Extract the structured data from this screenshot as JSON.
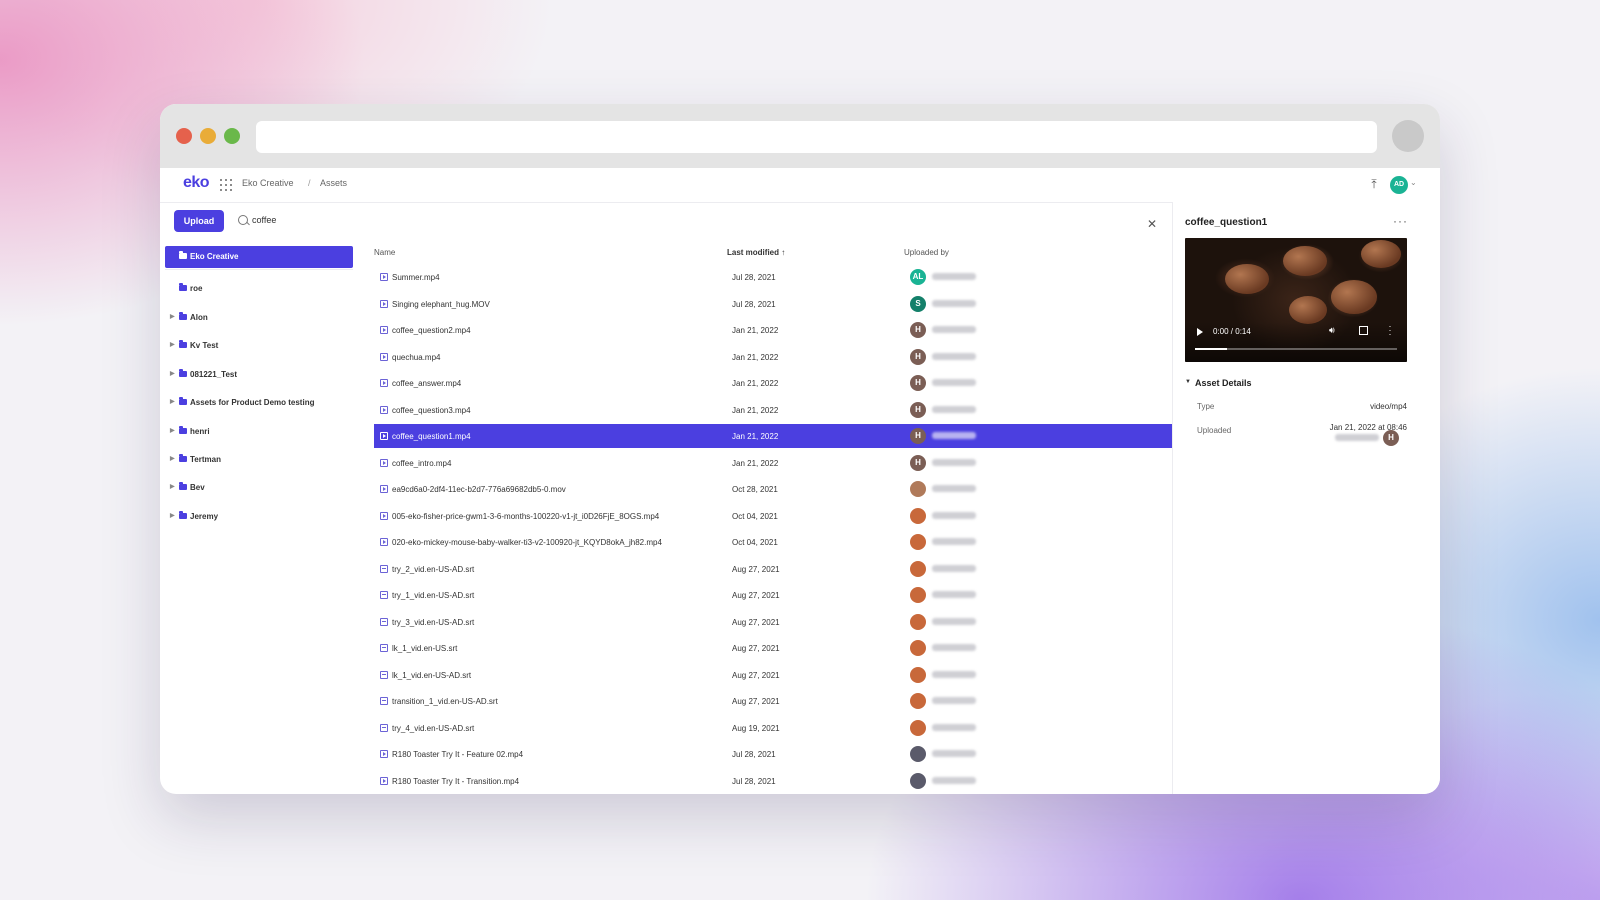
{
  "app": {
    "logo": "eko",
    "breadcrumb": [
      "Eko Creative",
      "Assets"
    ],
    "breadcrumb_separator": "/",
    "user_initials": "AD",
    "accent_color": "#4b3fe0"
  },
  "toolbar": {
    "upload_label": "Upload",
    "search_value": "coffee"
  },
  "sidebar": {
    "items": [
      {
        "label": "Eko Creative",
        "active": true,
        "expandable": false
      },
      {
        "label": "roe",
        "active": false,
        "expandable": false
      },
      {
        "label": "Alon",
        "active": false,
        "expandable": true
      },
      {
        "label": "Kv Test",
        "active": false,
        "expandable": true
      },
      {
        "label": "081221_Test",
        "active": false,
        "expandable": true
      },
      {
        "label": "Assets for Product Demo testing",
        "active": false,
        "expandable": true
      },
      {
        "label": "henri",
        "active": false,
        "expandable": true
      },
      {
        "label": "Tertman",
        "active": false,
        "expandable": true
      },
      {
        "label": "Bev",
        "active": false,
        "expandable": true
      },
      {
        "label": "Jeremy",
        "active": false,
        "expandable": true
      }
    ]
  },
  "table": {
    "columns": [
      "Name",
      "Last modified ↑",
      "Uploaded by"
    ],
    "rows": [
      {
        "name": "Summer.mp4",
        "date": "Jul 28, 2021",
        "type": "video",
        "avatar": "AL",
        "avatar_color": "#1ab394"
      },
      {
        "name": "Singing elephant_hug.MOV",
        "date": "Jul 28, 2021",
        "type": "video",
        "avatar": "S",
        "avatar_color": "#14806a"
      },
      {
        "name": "coffee_question2.mp4",
        "date": "Jan 21, 2022",
        "type": "video",
        "avatar": "H",
        "avatar_color": "#7b5e55"
      },
      {
        "name": "quechua.mp4",
        "date": "Jan 21, 2022",
        "type": "video",
        "avatar": "H",
        "avatar_color": "#7b5e55"
      },
      {
        "name": "coffee_answer.mp4",
        "date": "Jan 21, 2022",
        "type": "video",
        "avatar": "H",
        "avatar_color": "#7b5e55"
      },
      {
        "name": "coffee_question3.mp4",
        "date": "Jan 21, 2022",
        "type": "video",
        "avatar": "H",
        "avatar_color": "#7b5e55"
      },
      {
        "name": "coffee_question1.mp4",
        "date": "Jan 21, 2022",
        "type": "video",
        "avatar": "H",
        "avatar_color": "#7b5e55",
        "selected": true
      },
      {
        "name": "coffee_intro.mp4",
        "date": "Jan 21, 2022",
        "type": "video",
        "avatar": "H",
        "avatar_color": "#7b5e55"
      },
      {
        "name": "ea9cd6a0-2df4-11ec-b2d7-776a69682db5-0.mov",
        "date": "Oct 28, 2021",
        "type": "video",
        "avatar": "",
        "avatar_color": "#b07a5a"
      },
      {
        "name": "005-eko-fisher-price-gwm1-3-6-months-100220-v1-jt_i0D26FjE_8OGS.mp4",
        "date": "Oct 04, 2021",
        "type": "video",
        "avatar": "",
        "avatar_color": "#c8683a"
      },
      {
        "name": "020-eko-mickey-mouse-baby-walker-ti3-v2-100920-jt_KQYD8okA_jh82.mp4",
        "date": "Oct 04, 2021",
        "type": "video",
        "avatar": "",
        "avatar_color": "#c8683a"
      },
      {
        "name": "try_2_vid.en-US-AD.srt",
        "date": "Aug 27, 2021",
        "type": "subtitle",
        "avatar": "",
        "avatar_color": "#c8683a"
      },
      {
        "name": "try_1_vid.en-US-AD.srt",
        "date": "Aug 27, 2021",
        "type": "subtitle",
        "avatar": "",
        "avatar_color": "#c8683a"
      },
      {
        "name": "try_3_vid.en-US-AD.srt",
        "date": "Aug 27, 2021",
        "type": "subtitle",
        "avatar": "",
        "avatar_color": "#c8683a"
      },
      {
        "name": "lk_1_vid.en-US.srt",
        "date": "Aug 27, 2021",
        "type": "subtitle",
        "avatar": "",
        "avatar_color": "#c8683a"
      },
      {
        "name": "lk_1_vid.en-US-AD.srt",
        "date": "Aug 27, 2021",
        "type": "subtitle",
        "avatar": "",
        "avatar_color": "#c8683a"
      },
      {
        "name": "transition_1_vid.en-US-AD.srt",
        "date": "Aug 27, 2021",
        "type": "subtitle",
        "avatar": "",
        "avatar_color": "#c8683a"
      },
      {
        "name": "try_4_vid.en-US-AD.srt",
        "date": "Aug 19, 2021",
        "type": "subtitle",
        "avatar": "",
        "avatar_color": "#c8683a"
      },
      {
        "name": "R180 Toaster Try It - Feature 02.mp4",
        "date": "Jul 28, 2021",
        "type": "video",
        "avatar": "",
        "avatar_color": "#5a5a6a"
      },
      {
        "name": "R180 Toaster Try It - Transition.mp4",
        "date": "Jul 28, 2021",
        "type": "video",
        "avatar": "",
        "avatar_color": "#5a5a6a"
      }
    ]
  },
  "panel": {
    "title": "coffee_question1",
    "more_label": "···",
    "video_time": "0:00 / 0:14",
    "video_progress": 0.16,
    "details_heading": "Asset Details",
    "type_label": "Type",
    "type_value": "video/mp4",
    "uploaded_label": "Uploaded",
    "uploaded_value": "Jan 21, 2022 at 08:46",
    "uploader_initial": "H"
  }
}
